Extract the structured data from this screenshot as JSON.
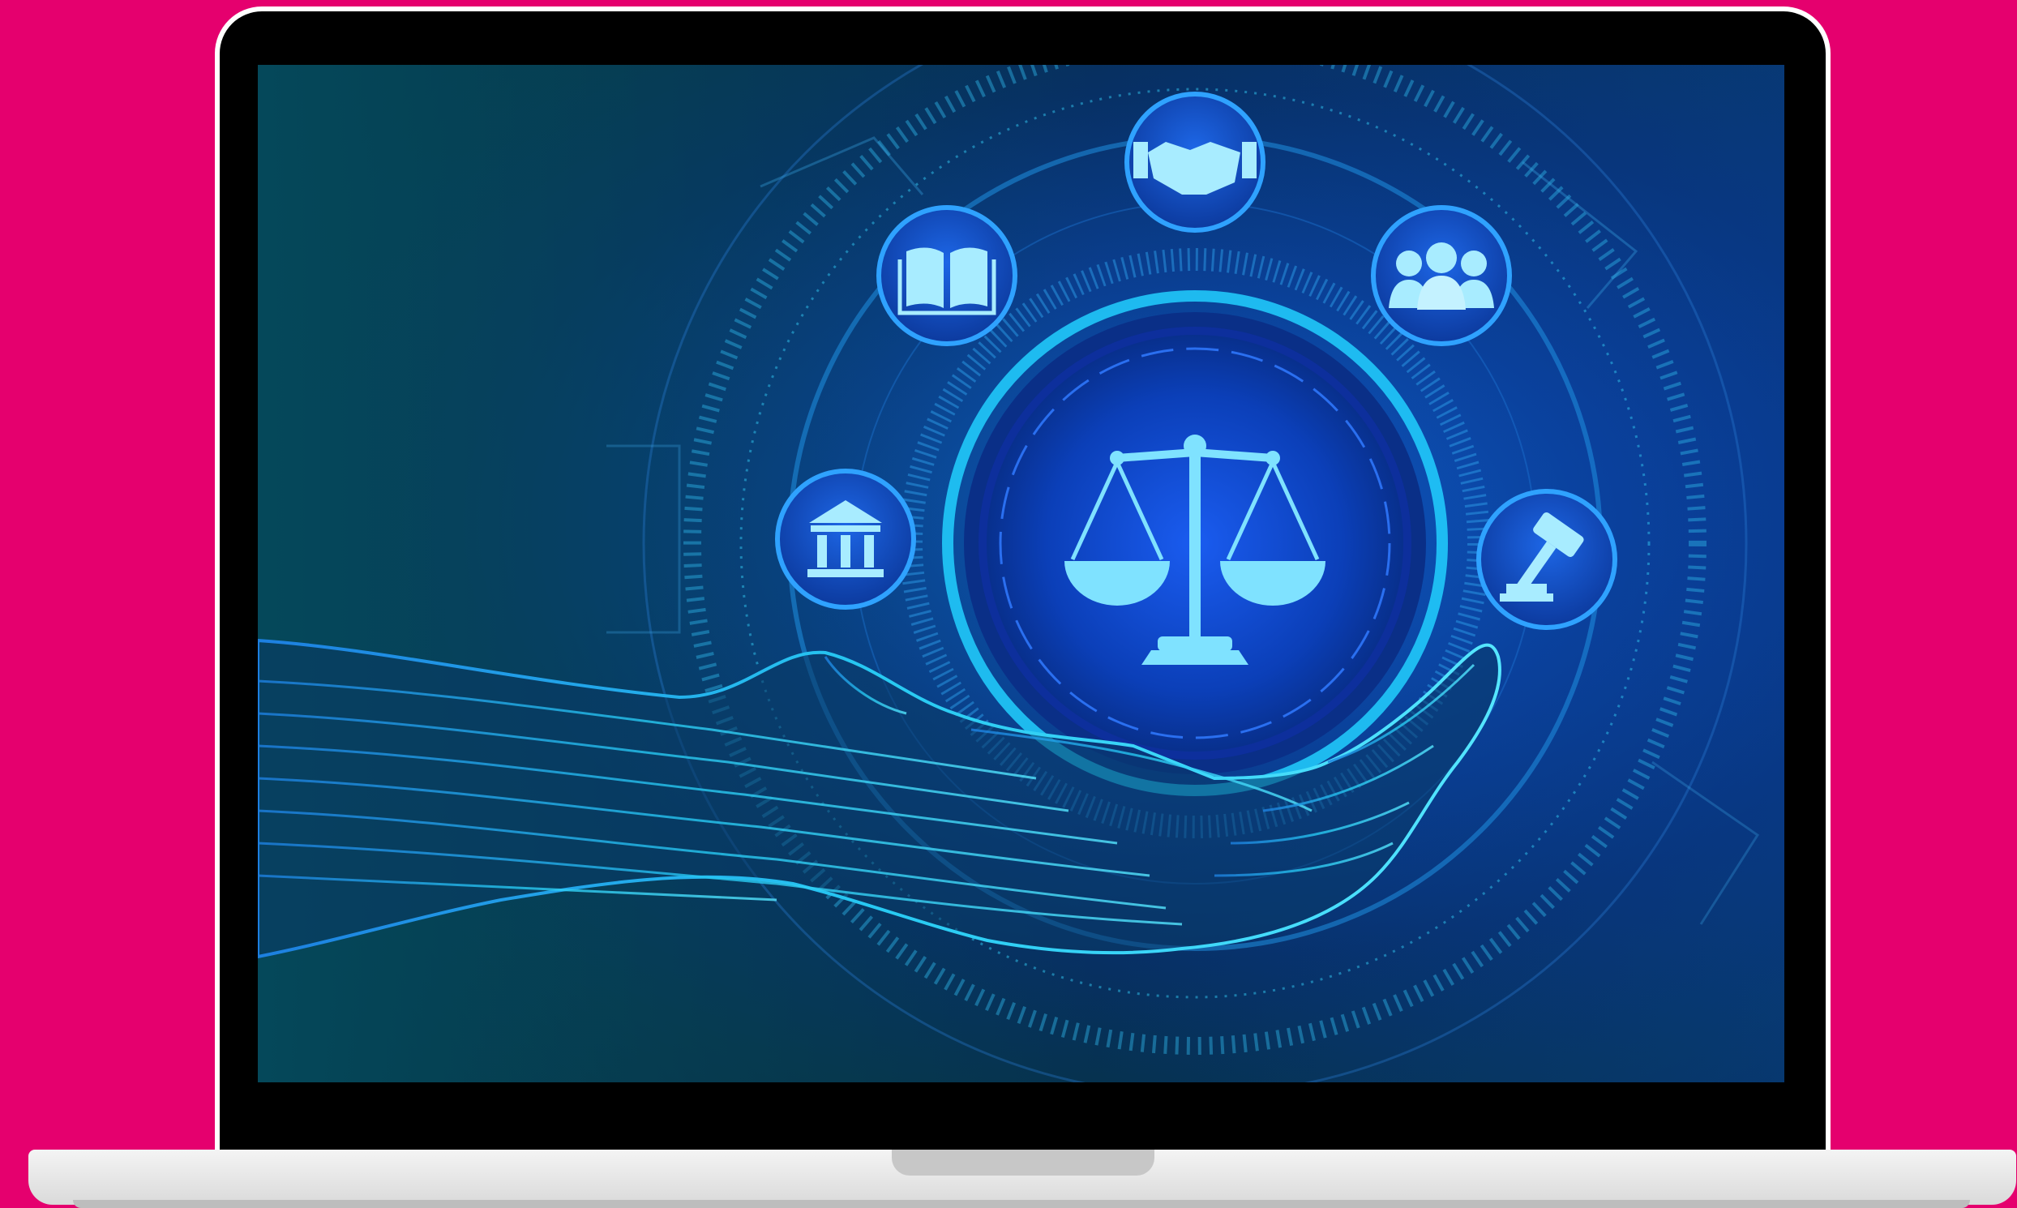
{
  "scene": {
    "background_color": "#e5006e",
    "device": "laptop",
    "screen_content": "digital-hand-with-justice-scale",
    "accent_color": "#26d6ff",
    "icons": [
      "scale-of-justice-icon",
      "handshake-icon",
      "open-book-icon",
      "people-group-icon",
      "courthouse-icon",
      "gavel-icon"
    ]
  }
}
